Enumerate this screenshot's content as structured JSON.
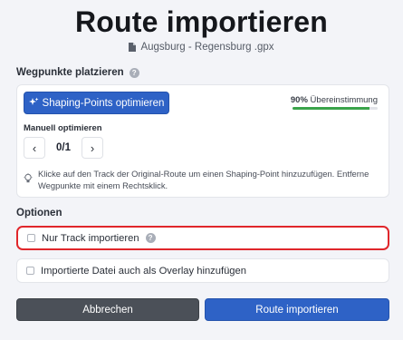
{
  "header": {
    "title": "Route importieren",
    "file_name": "Augsburg - Regensburg .gpx"
  },
  "waypoints": {
    "section_label": "Wegpunkte platzieren",
    "optimize_button_label": "Shaping-Points optimieren",
    "match_percent_label": "90%",
    "match_text": "Übereinstimmung",
    "match_value": 0.9,
    "manual_label": "Manuell optimieren",
    "pager": {
      "prev": "‹",
      "count": "0/1",
      "next": "›"
    },
    "hint": "Klicke auf den Track der Original-Route um einen Shaping-Point hinzuzufügen. Entferne Wegpunkte mit einem Rechtsklick."
  },
  "options": {
    "section_label": "Optionen",
    "track_only_label": "Nur Track importieren",
    "overlay_label": "Importierte Datei auch als Overlay hinzufügen"
  },
  "footer": {
    "cancel_label": "Abbrechen",
    "import_label": "Route importieren"
  },
  "colors": {
    "primary": "#2e62c6",
    "secondary": "#4b5058",
    "highlight": "#e0262b",
    "match_bar": "#3aa34a"
  },
  "icons": [
    "file-icon",
    "help-icon",
    "sparkle-icon",
    "chevron-left-icon",
    "chevron-right-icon",
    "lightbulb-icon",
    "checkbox-icon"
  ]
}
